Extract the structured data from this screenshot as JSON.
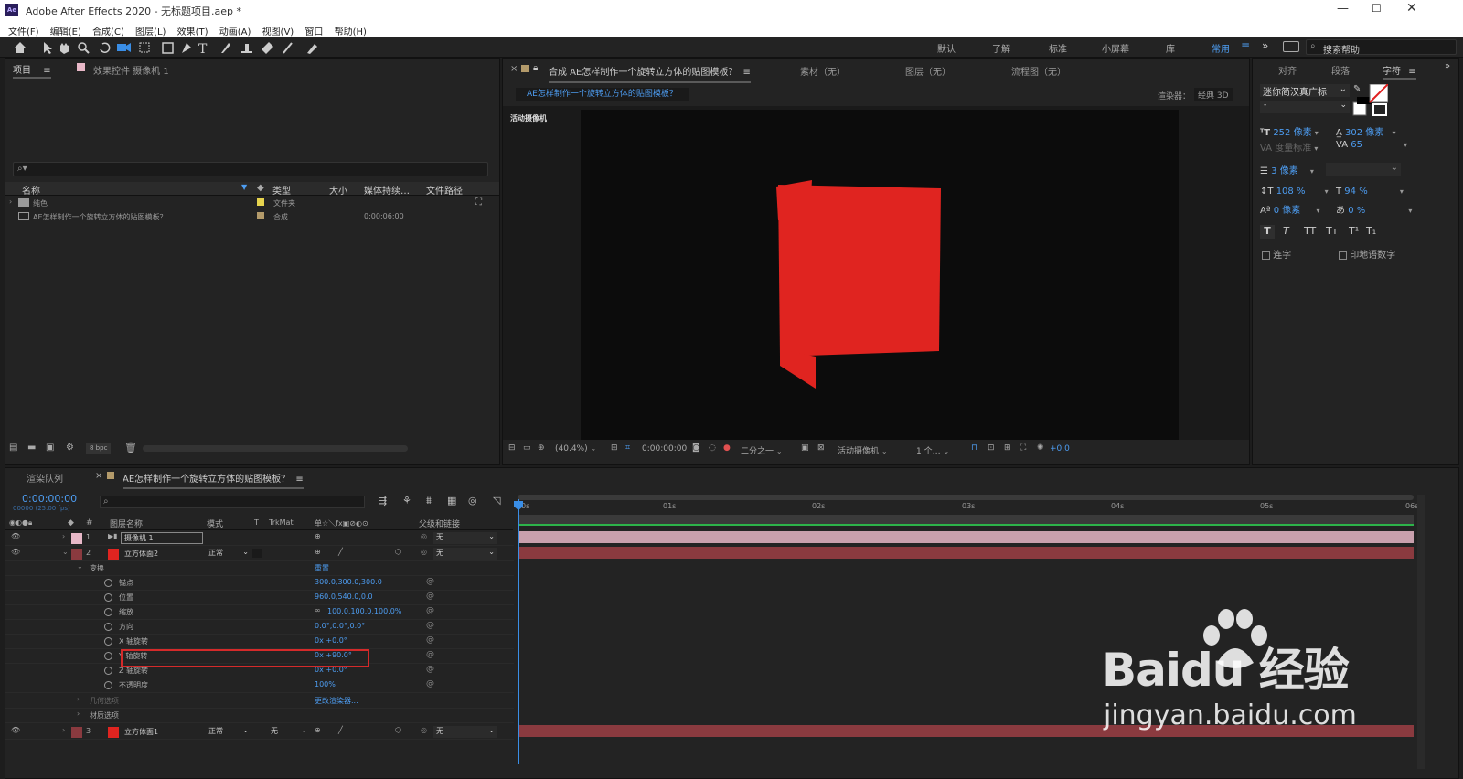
{
  "window": {
    "title": "Adobe After Effects 2020 - 无标题项目.aep *",
    "app_icon": "Ae"
  },
  "menu": [
    "文件(F)",
    "编辑(E)",
    "合成(C)",
    "图层(L)",
    "效果(T)",
    "动画(A)",
    "视图(V)",
    "窗口",
    "帮助(H)"
  ],
  "workspaces": {
    "items": [
      "默认",
      "了解",
      "标准",
      "小屏幕",
      "库",
      "常用"
    ],
    "active": "常用",
    "search_placeholder": "搜索帮助"
  },
  "project_panel": {
    "tab_project": "项目",
    "tab_effects": "效果控件 摄像机 1",
    "search_placeholder": "",
    "columns": [
      "名称",
      "类型",
      "大小",
      "媒体持续…",
      "文件路径"
    ],
    "items": [
      {
        "name": "纯色",
        "type": "文件夹",
        "duration": "",
        "color": "#e6d34e"
      },
      {
        "name": "AE怎样制作一个旋转立方体的贴图模板？",
        "type": "合成",
        "duration": "0:00:06:00",
        "color": "#b39a6a"
      }
    ],
    "bpc": "8 bpc"
  },
  "comp_panel": {
    "tab_label": "合成 AE怎样制作一个旋转立方体的贴图模板？",
    "tab_footage": "素材（无）",
    "tab_layer": "图层（无）",
    "tab_flow": "流程图（无）",
    "breadcrumb": "AE怎样制作一个旋转立方体的贴图模板？",
    "renderer_label": "渲染器：",
    "renderer_value": "经典 3D",
    "view_label": "活动摄像机",
    "footer": {
      "zoom": "(40.4%)",
      "time": "0:00:00:00",
      "resolution": "二分之一",
      "camera": "活动摄像机",
      "views": "1 个…",
      "exposure": "+0.0"
    }
  },
  "character_panel": {
    "tabs": [
      "对齐",
      "段落",
      "字符"
    ],
    "active_tab": "字符",
    "font": "迷你简汉真广标",
    "style": "-",
    "font_size": "252 像素",
    "leading": "302 像素",
    "kerning": "度量标准",
    "tracking": "65",
    "stroke": "3 像素",
    "vscale": "108 %",
    "hscale": "94 %",
    "baseline": "0 像素",
    "tsume": "0 %",
    "style_buttons": [
      "T",
      "T",
      "TT",
      "Tт",
      "T¹",
      "T₁"
    ],
    "ligature": "连字",
    "hindi": "印地语数字"
  },
  "timeline": {
    "tab_render": "渲染队列",
    "tab_comp": "AE怎样制作一个旋转立方体的贴图模板？",
    "timecode": "0:00:00:00",
    "fps": "00000 (25.00 fps)",
    "columns": {
      "name": "图层名称",
      "mode": "模式",
      "t": "T",
      "trkmat": "TrkMat",
      "switches": "单☆＼fx▣⊘◐⊙",
      "parent": "父级和链接"
    },
    "ruler": [
      "0s",
      "01s",
      "02s",
      "03s",
      "04s",
      "05s",
      "06s"
    ],
    "layers": [
      {
        "num": "1",
        "name": "摄像机 1",
        "parent": "无",
        "color": "#e8b8c8",
        "mode": ""
      },
      {
        "num": "2",
        "name": "立方体面2",
        "mode": "正常",
        "parent": "无",
        "color": "#cc2f2f"
      },
      {
        "num": "3",
        "name": "立方体面1",
        "mode": "正常",
        "trkmat": "无",
        "parent": "无",
        "color": "#cc2f2f"
      }
    ],
    "transform": {
      "label": "变换",
      "reset": "重置"
    },
    "props": [
      {
        "name": "锚点",
        "value": "300.0,300.0,300.0"
      },
      {
        "name": "位置",
        "value": "960.0,540.0,0.0"
      },
      {
        "name": "缩放",
        "value": "100.0,100.0,100.0%"
      },
      {
        "name": "方向",
        "value": "0.0°,0.0°,0.0°"
      },
      {
        "name": "X 轴旋转",
        "value": "0x +0.0°"
      },
      {
        "name": "Y 轴旋转",
        "value": "0x +90.0°"
      },
      {
        "name": "Z 轴旋转",
        "value": "0x +0.0°"
      },
      {
        "name": "不透明度",
        "value": "100%"
      }
    ],
    "geometry": {
      "label": "几何选项",
      "value": "更改渲染器..."
    },
    "material": "材质选项"
  },
  "watermark": {
    "brand": "Baidu 经验",
    "url": "jingyan.baidu.com"
  },
  "colors": {
    "accent": "#4d9cf0",
    "red_face": "#e02420",
    "layer_red": "#8a3a3f",
    "camera_pink": "#c9a0ad"
  }
}
